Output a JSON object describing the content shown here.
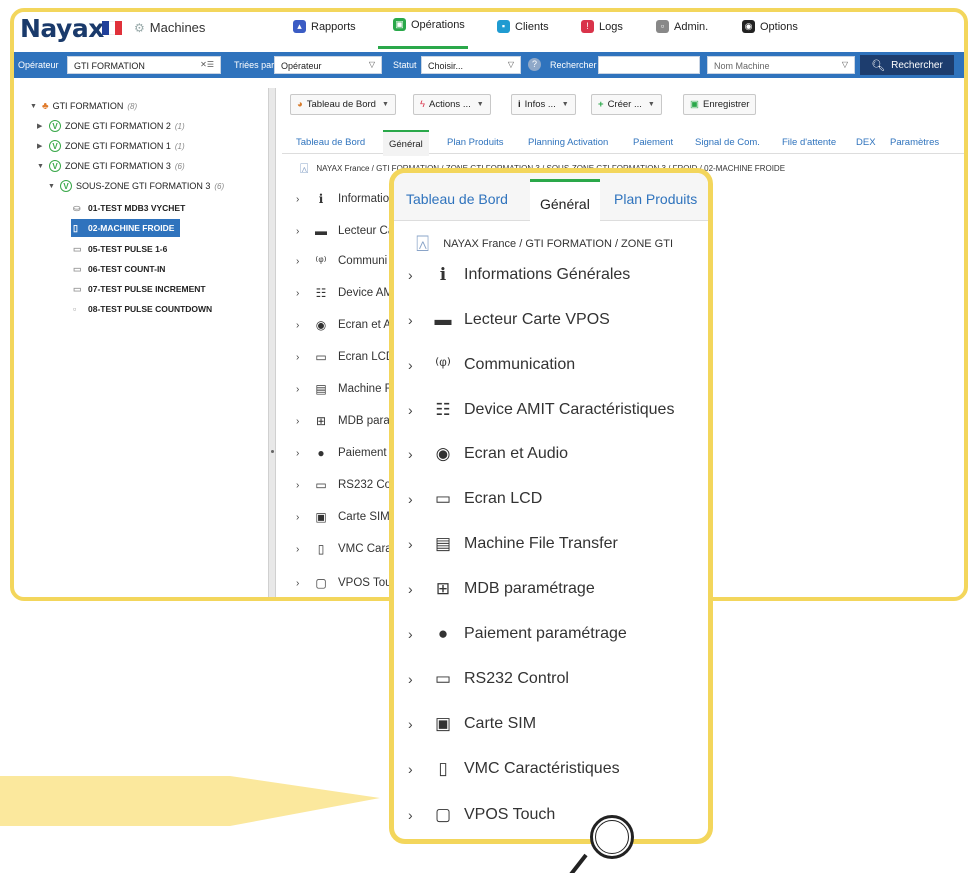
{
  "colors": {
    "highlight_yellow": "#f3d65c",
    "filter_bar_blue": "#2f73bd",
    "search_button_navy": "#1d3d6e",
    "active_tab_green": "#2aa84a",
    "brand_navy": "#1a3a6b"
  },
  "header": {
    "logo_text": "Nayax",
    "section_title": "Machines",
    "nav": [
      {
        "label": "Rapports",
        "icon": "chart-icon",
        "color": "#3b5cc4"
      },
      {
        "label": "Opérations",
        "icon": "operations-icon",
        "color": "#2aa84a",
        "active": true
      },
      {
        "label": "Clients",
        "icon": "clients-icon",
        "color": "#1f9bd1"
      },
      {
        "label": "Logs",
        "icon": "logs-icon",
        "color": "#d9334a"
      },
      {
        "label": "Admin.",
        "icon": "admin-icon",
        "color": "#666666"
      },
      {
        "label": "Options",
        "icon": "options-icon",
        "color": "#222222"
      }
    ]
  },
  "filters": {
    "operator_label": "Opérateur",
    "operator_value": "GTI FORMATION",
    "sorted_by_label": "Triées par",
    "sorted_by_value": "Opérateur",
    "status_label": "Statut",
    "status_value": "Choisir...",
    "search_label": "Rechercher",
    "search_value": "",
    "field_value": "Nom Machine",
    "search_button": "Rechercher"
  },
  "tree": {
    "root": {
      "label": "GTI FORMATION",
      "count": "(8)"
    },
    "zones": [
      {
        "label": "ZONE GTI FORMATION 2",
        "count": "(1)"
      },
      {
        "label": "ZONE GTI FORMATION 1",
        "count": "(1)"
      },
      {
        "label": "ZONE GTI FORMATION 3",
        "count": "(6)"
      }
    ],
    "subzone": {
      "label": "SOUS-ZONE GTI FORMATION 3",
      "count": "(6)"
    },
    "machines": [
      {
        "label": "01-TEST MDB3 VYCHET",
        "selected": false
      },
      {
        "label": "02-MACHINE FROIDE",
        "selected": true
      },
      {
        "label": "05-TEST PULSE 1-6",
        "selected": false
      },
      {
        "label": "06-TEST COUNT-IN",
        "selected": false
      },
      {
        "label": "07-TEST PULSE INCREMENT",
        "selected": false
      },
      {
        "label": "08-TEST PULSE COUNTDOWN",
        "selected": false
      }
    ]
  },
  "toolbar": {
    "dashboard": "Tableau de Bord",
    "actions": "Actions ...",
    "infos": "Infos ...",
    "create": "Créer ...",
    "save": "Enregistrer"
  },
  "tabs": [
    "Tableau de Bord",
    "Général",
    "Plan Produits",
    "Planning Activation",
    "Paiement",
    "Signal de Com.",
    "File d'attente",
    "DEX",
    "Paramètres"
  ],
  "active_tab": "Général",
  "breadcrumb": "NAYAX France / GTI FORMATION / ZONE GTI FORMATION 3 / SOUS-ZONE GTI FORMATION 3 / FROID / 02-MACHINE FROIDE",
  "sections_truncated": [
    "Informatio",
    "Lecteur Ca",
    "Communi",
    "Device AM",
    "Ecran et A",
    "Ecran LCD",
    "Machine F",
    "MDB para",
    "Paiement",
    "RS232 Cor",
    "Carte SIM",
    "VMC Cara",
    "VPOS Tou"
  ],
  "zoom": {
    "tabs": [
      "Tableau de Bord",
      "Général",
      "Plan Produits"
    ],
    "breadcrumb": "NAYAX France / GTI FORMATION / ZONE GTI",
    "sections": [
      {
        "label": "Informations Générales",
        "icon": "info-icon"
      },
      {
        "label": "Lecteur Carte VPOS",
        "icon": "card-reader-icon"
      },
      {
        "label": "Communication",
        "icon": "antenna-icon"
      },
      {
        "label": "Device AMIT Caractéristiques",
        "icon": "device-list-icon"
      },
      {
        "label": "Ecran et Audio",
        "icon": "screen-audio-icon"
      },
      {
        "label": "Ecran LCD",
        "icon": "lcd-icon"
      },
      {
        "label": "Machine File Transfer",
        "icon": "ftp-icon"
      },
      {
        "label": "MDB paramétrage",
        "icon": "mdb-icon"
      },
      {
        "label": "Paiement paramétrage",
        "icon": "payment-icon"
      },
      {
        "label": "RS232 Control",
        "icon": "rs232-icon"
      },
      {
        "label": "Carte SIM",
        "icon": "sim-icon"
      },
      {
        "label": "VMC Caractéristiques",
        "icon": "vmc-icon"
      },
      {
        "label": "VPOS Touch",
        "icon": "vpos-touch-icon"
      }
    ]
  }
}
